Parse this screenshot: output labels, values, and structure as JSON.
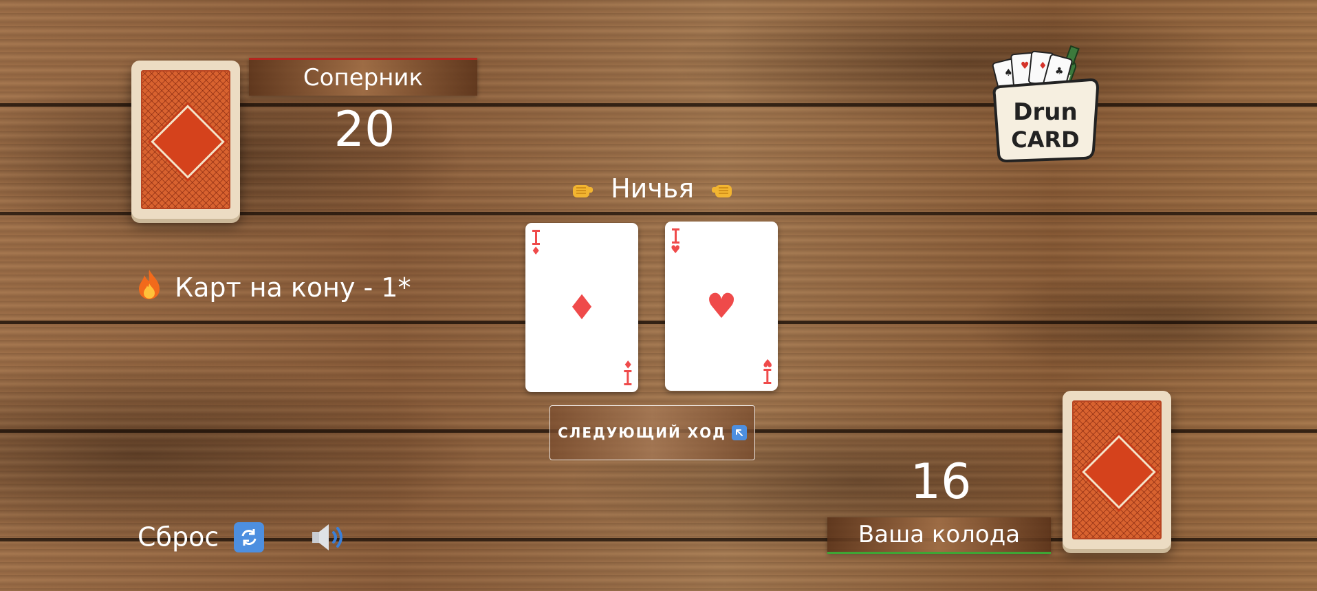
{
  "opponent": {
    "label": "Соперник",
    "count": "20"
  },
  "player": {
    "label": "Ваша колода",
    "count": "16"
  },
  "round_result": {
    "text": "Ничья",
    "icon": "fist-icon"
  },
  "pot": {
    "text": "Карт на кону - 1*",
    "icon": "fire-icon"
  },
  "played_cards": [
    {
      "suit": "♦",
      "suit_name": "diamonds",
      "color": "#ef4a4a"
    },
    {
      "suit": "♥",
      "suit_name": "hearts",
      "color": "#ef4a4a"
    }
  ],
  "next_button": {
    "label": "СЛЕДУЮЩИЙ ХОД",
    "icon": "arrow-up-left-icon"
  },
  "reset": {
    "label": "Сброс",
    "icon": "refresh-icon"
  },
  "sound": {
    "icon": "speaker-icon"
  },
  "logo": {
    "line1": "Drun",
    "line2": "CARD"
  },
  "colors": {
    "opponent_accent": "#b3261e",
    "player_accent": "#3fa535",
    "card_suit": "#ef4a4a",
    "card_back": "#d8622f"
  }
}
